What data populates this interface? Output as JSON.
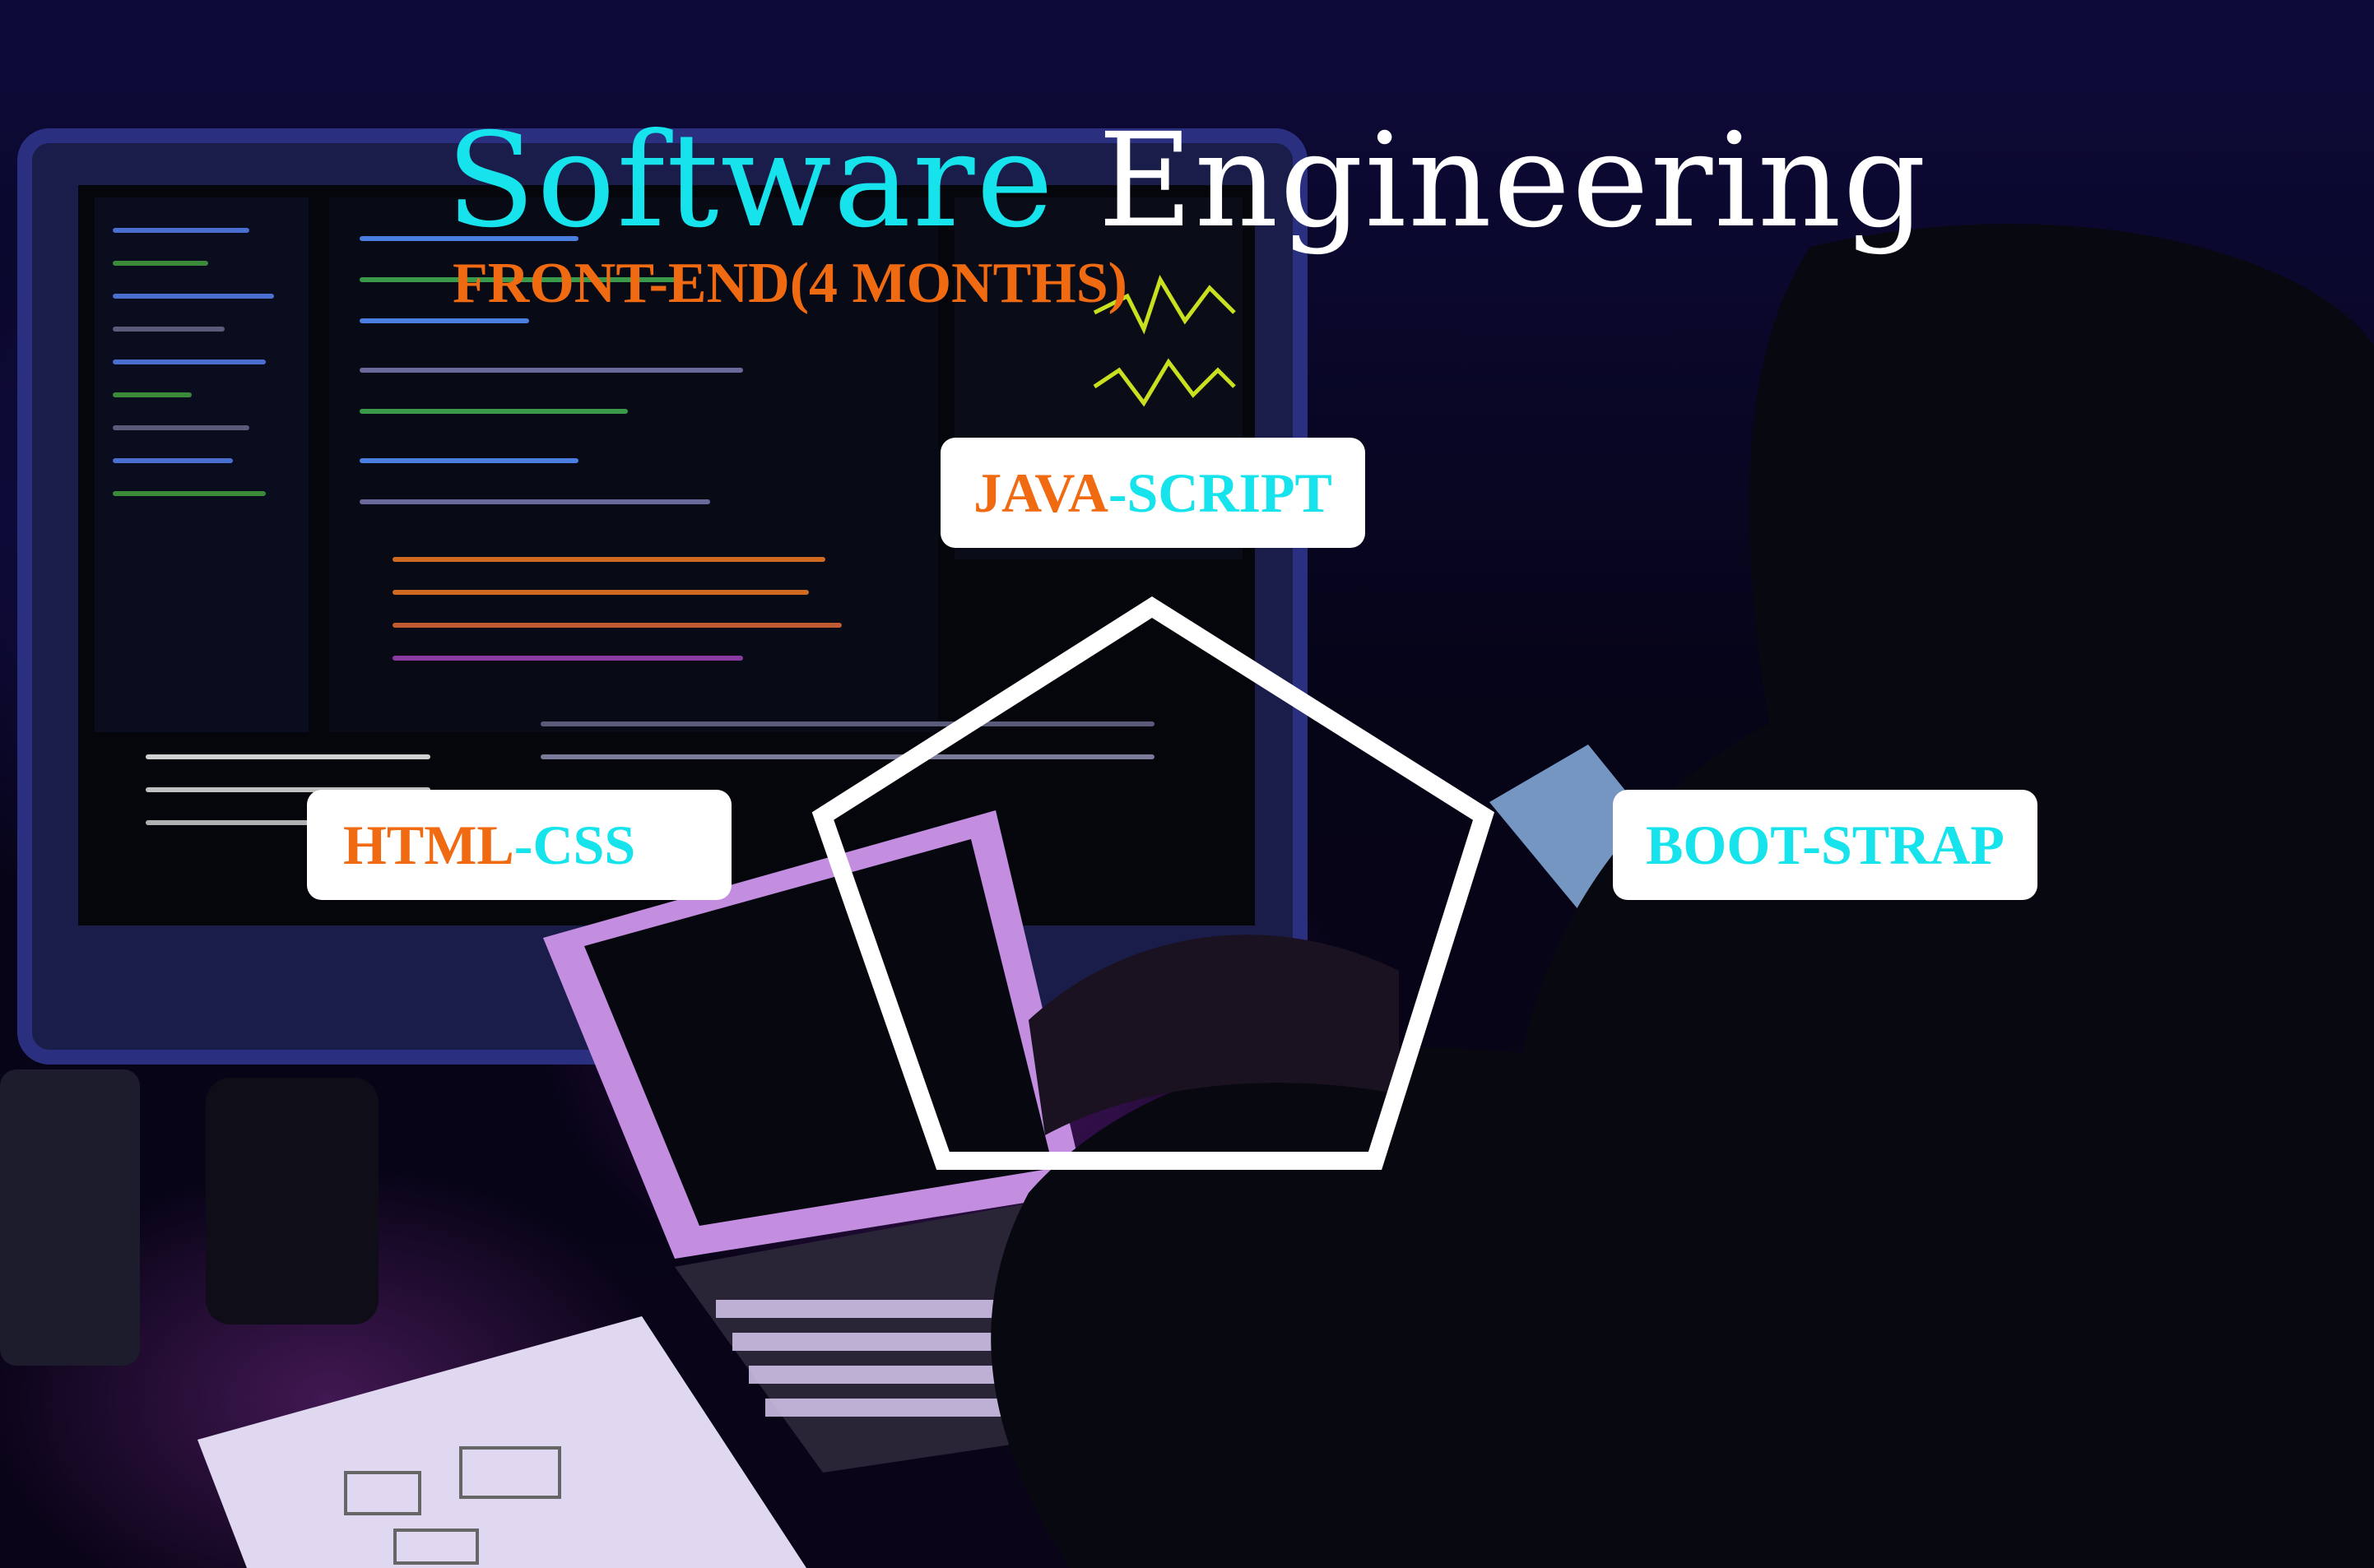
{
  "title": {
    "word1": "Software",
    "word2": "Engineering"
  },
  "subtitle": "FRONT-END(4 MONTHS)",
  "topics": {
    "javascript": {
      "part1": "JAVA",
      "part2": "-SCRIPT"
    },
    "html_css": {
      "part1": "HTML",
      "part2": "-CSS"
    },
    "bootstrap": {
      "part1": "BOOT-STRAP"
    }
  },
  "colors": {
    "cyan": "#16e3ec",
    "orange": "#f06a12",
    "white": "#ffffff"
  }
}
